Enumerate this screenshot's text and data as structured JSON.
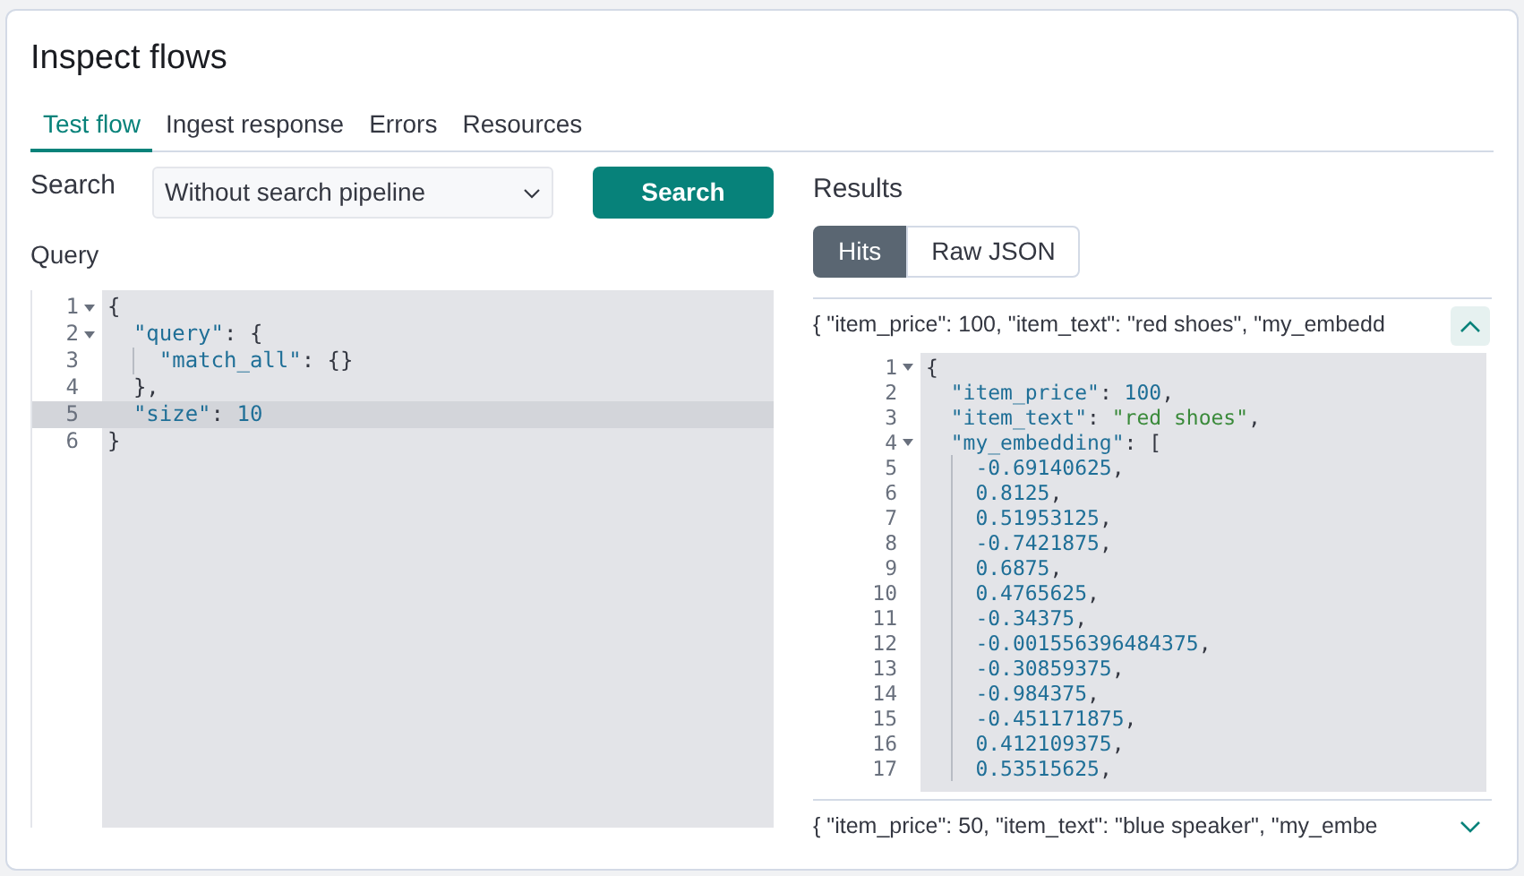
{
  "title": "Inspect flows",
  "tabs": [
    {
      "label": "Test flow",
      "selected": true
    },
    {
      "label": "Ingest response",
      "selected": false
    },
    {
      "label": "Errors",
      "selected": false
    },
    {
      "label": "Resources",
      "selected": false
    }
  ],
  "search": {
    "label": "Search",
    "pipeline": "Without search pipeline",
    "button": "Search"
  },
  "query": {
    "label": "Query",
    "lines": [
      {
        "number": "1",
        "kind": "top",
        "fold": true,
        "highlighted": false,
        "tokens": [
          {
            "text": "{",
            "kind": "punct"
          }
        ]
      },
      {
        "number": "2",
        "kind": "inner",
        "fold": true,
        "highlighted": false,
        "tokens": [
          {
            "text": "\"query\"",
            "kind": "key"
          },
          {
            "text": ": {",
            "kind": "punct"
          }
        ]
      },
      {
        "number": "3",
        "kind": "nested",
        "fold": false,
        "highlighted": false,
        "tokens": [
          {
            "text": "\"match_all\"",
            "kind": "key"
          },
          {
            "text": ": {}",
            "kind": "punct"
          }
        ]
      },
      {
        "number": "4",
        "kind": "inner",
        "fold": false,
        "highlighted": false,
        "tokens": [
          {
            "text": "},",
            "kind": "punct"
          }
        ]
      },
      {
        "number": "5",
        "kind": "inner",
        "fold": false,
        "highlighted": true,
        "tokens": [
          {
            "text": "\"size\"",
            "kind": "key"
          },
          {
            "text": ": ",
            "kind": "punct"
          },
          {
            "text": "10",
            "kind": "number"
          }
        ]
      },
      {
        "number": "6",
        "kind": "top",
        "fold": false,
        "highlighted": false,
        "tokens": [
          {
            "text": "}",
            "kind": "punct"
          }
        ]
      }
    ]
  },
  "results": {
    "label": "Results",
    "views": [
      {
        "label": "Hits",
        "selected": true
      },
      {
        "label": "Raw JSON",
        "selected": false
      }
    ],
    "hits": [
      {
        "summary": "{ \"item_price\": 100, \"item_text\": \"red shoes\", \"my_embedd",
        "expanded": true,
        "lines": [
          {
            "number": "1",
            "kind": "top",
            "fold": true,
            "tokens": [
              {
                "text": "{",
                "kind": "punct"
              }
            ]
          },
          {
            "number": "2",
            "kind": "inner",
            "fold": false,
            "tokens": [
              {
                "text": "\"item_price\"",
                "kind": "key"
              },
              {
                "text": ": ",
                "kind": "punct"
              },
              {
                "text": "100",
                "kind": "number"
              },
              {
                "text": ",",
                "kind": "punct"
              }
            ]
          },
          {
            "number": "3",
            "kind": "inner",
            "fold": false,
            "tokens": [
              {
                "text": "\"item_text\"",
                "kind": "key"
              },
              {
                "text": ": ",
                "kind": "punct"
              },
              {
                "text": "\"red shoes\"",
                "kind": "string"
              },
              {
                "text": ",",
                "kind": "punct"
              }
            ]
          },
          {
            "number": "4",
            "kind": "inner",
            "fold": true,
            "tokens": [
              {
                "text": "\"my_embedding\"",
                "kind": "key"
              },
              {
                "text": ": [",
                "kind": "punct"
              }
            ]
          },
          {
            "number": "5",
            "kind": "nested",
            "fold": false,
            "tokens": [
              {
                "text": "-0.69140625",
                "kind": "number"
              },
              {
                "text": ",",
                "kind": "punct"
              }
            ]
          },
          {
            "number": "6",
            "kind": "nested",
            "fold": false,
            "tokens": [
              {
                "text": "0.8125",
                "kind": "number"
              },
              {
                "text": ",",
                "kind": "punct"
              }
            ]
          },
          {
            "number": "7",
            "kind": "nested",
            "fold": false,
            "tokens": [
              {
                "text": "0.51953125",
                "kind": "number"
              },
              {
                "text": ",",
                "kind": "punct"
              }
            ]
          },
          {
            "number": "8",
            "kind": "nested",
            "fold": false,
            "tokens": [
              {
                "text": "-0.7421875",
                "kind": "number"
              },
              {
                "text": ",",
                "kind": "punct"
              }
            ]
          },
          {
            "number": "9",
            "kind": "nested",
            "fold": false,
            "tokens": [
              {
                "text": "0.6875",
                "kind": "number"
              },
              {
                "text": ",",
                "kind": "punct"
              }
            ]
          },
          {
            "number": "10",
            "kind": "nested",
            "fold": false,
            "tokens": [
              {
                "text": "0.4765625",
                "kind": "number"
              },
              {
                "text": ",",
                "kind": "punct"
              }
            ]
          },
          {
            "number": "11",
            "kind": "nested",
            "fold": false,
            "tokens": [
              {
                "text": "-0.34375",
                "kind": "number"
              },
              {
                "text": ",",
                "kind": "punct"
              }
            ]
          },
          {
            "number": "12",
            "kind": "nested",
            "fold": false,
            "tokens": [
              {
                "text": "-0.001556396484375",
                "kind": "number"
              },
              {
                "text": ",",
                "kind": "punct"
              }
            ]
          },
          {
            "number": "13",
            "kind": "nested",
            "fold": false,
            "tokens": [
              {
                "text": "-0.30859375",
                "kind": "number"
              },
              {
                "text": ",",
                "kind": "punct"
              }
            ]
          },
          {
            "number": "14",
            "kind": "nested",
            "fold": false,
            "tokens": [
              {
                "text": "-0.984375",
                "kind": "number"
              },
              {
                "text": ",",
                "kind": "punct"
              }
            ]
          },
          {
            "number": "15",
            "kind": "nested",
            "fold": false,
            "tokens": [
              {
                "text": "-0.451171875",
                "kind": "number"
              },
              {
                "text": ",",
                "kind": "punct"
              }
            ]
          },
          {
            "number": "16",
            "kind": "nested",
            "fold": false,
            "tokens": [
              {
                "text": "0.412109375",
                "kind": "number"
              },
              {
                "text": ",",
                "kind": "punct"
              }
            ]
          },
          {
            "number": "17",
            "kind": "nested",
            "fold": false,
            "tokens": [
              {
                "text": "0.53515625",
                "kind": "number"
              },
              {
                "text": ",",
                "kind": "punct"
              }
            ]
          }
        ]
      },
      {
        "summary": "{ \"item_price\": 50, \"item_text\": \"blue speaker\", \"my_embe",
        "expanded": false
      }
    ]
  }
}
